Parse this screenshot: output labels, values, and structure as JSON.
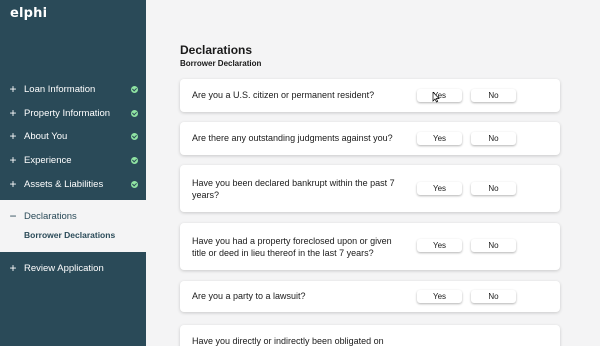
{
  "app": {
    "logo": "elphi"
  },
  "sidebar": {
    "items": [
      {
        "label": "Loan Information",
        "icon": "plus-icon",
        "completed": true
      },
      {
        "label": "Property Information",
        "icon": "plus-icon",
        "completed": true
      },
      {
        "label": "About You",
        "icon": "plus-icon",
        "completed": true
      },
      {
        "label": "Experience",
        "icon": "plus-icon",
        "completed": true
      },
      {
        "label": "Assets & Liabilities",
        "icon": "plus-icon",
        "completed": true
      },
      {
        "label": "Declarations",
        "icon": "minus-icon",
        "active": true,
        "sub_items": [
          {
            "label": "Borrower Declarations"
          }
        ]
      },
      {
        "label": "Review Application",
        "icon": "plus-icon",
        "completed": false
      }
    ]
  },
  "main": {
    "title": "Declarations",
    "subtitle": "Borrower Declaration",
    "questions": [
      {
        "text": "Are you a U.S. citizen or permanent resident?",
        "yes": "Yes",
        "no": "No"
      },
      {
        "text": "Are there any outstanding judgments against you?",
        "yes": "Yes",
        "no": "No"
      },
      {
        "text": "Have you been declared bankrupt within the past 7 years?",
        "yes": "Yes",
        "no": "No"
      },
      {
        "text": "Have you had a property foreclosed upon or given title or deed in lieu thereof in the last 7 years?",
        "yes": "Yes",
        "no": "No"
      },
      {
        "text": "Are you a party to a lawsuit?",
        "yes": "Yes",
        "no": "No"
      },
      {
        "text": "Have you directly or indirectly been obligated on",
        "yes": "",
        "no": ""
      }
    ]
  },
  "colors": {
    "sidebar_bg": "#2a4a58",
    "check_green": "#8fe3a2",
    "page_bg": "#f4f4f5"
  }
}
